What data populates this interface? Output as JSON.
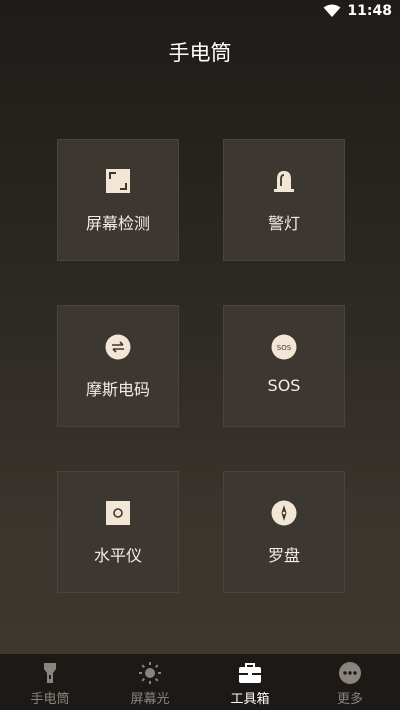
{
  "status": {
    "time": "11:48"
  },
  "header": {
    "title": "手电筒"
  },
  "tools": [
    {
      "label": "屏幕检测",
      "icon": "screen-frame-icon"
    },
    {
      "label": "警灯",
      "icon": "siren-icon"
    },
    {
      "label": "摩斯电码",
      "icon": "swap-arrows-icon"
    },
    {
      "label": "SOS",
      "icon": "sos-icon",
      "icon_text": "SOS"
    },
    {
      "label": "水平仪",
      "icon": "level-icon"
    },
    {
      "label": "罗盘",
      "icon": "compass-icon"
    }
  ],
  "nav": [
    {
      "label": "手电筒",
      "icon": "flashlight-icon",
      "active": false
    },
    {
      "label": "屏幕光",
      "icon": "sun-icon",
      "active": false
    },
    {
      "label": "工具箱",
      "icon": "toolbox-icon",
      "active": true
    },
    {
      "label": "更多",
      "icon": "more-icon",
      "active": false
    }
  ],
  "colors": {
    "tile_bg": "#3d3731",
    "icon_fill": "#f3e6d4",
    "nav_bg": "#1c1917",
    "nav_inactive": "#8a847c"
  }
}
